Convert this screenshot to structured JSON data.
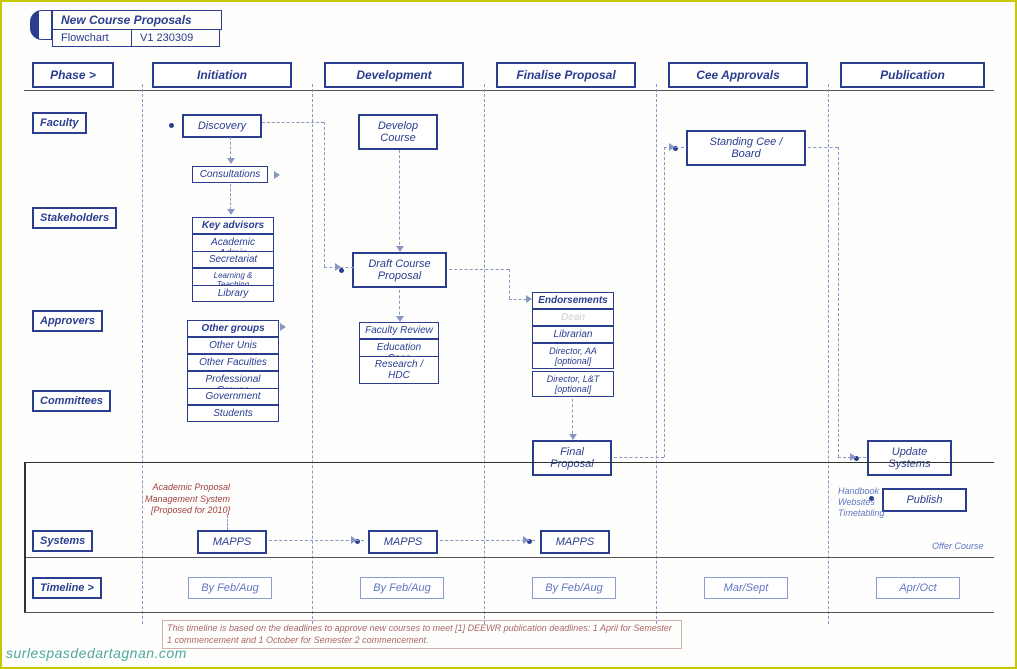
{
  "title": {
    "main": "New Course Proposals",
    "sub1": "Flowchart",
    "sub2": "V1 230309"
  },
  "phases": {
    "label": "Phase >",
    "cols": [
      "Initiation",
      "Development",
      "Finalise Proposal",
      "Cee Approvals",
      "Publication"
    ]
  },
  "rows": {
    "faculty": "Faculty",
    "stakeholders": "Stakeholders",
    "approvers": "Approvers",
    "committees": "Committees",
    "systems": "Systems",
    "timeline": "Timeline >"
  },
  "boxes": {
    "discovery": "Discovery",
    "consultations": "Consultations",
    "develop_course": "Develop Course",
    "draft_proposal": "Draft Course Proposal",
    "final_proposal": "Final Proposal",
    "standing_cee": "Standing Cee  / Board",
    "update_systems": "Update Systems",
    "publish": "Publish"
  },
  "small_boxes": {
    "stakeholders": [
      "Key advisors",
      "Academic Admin",
      "Secretariat",
      "Learning & Teaching",
      "Library"
    ],
    "other_groups": [
      "Other groups",
      "Other Unis",
      "Other Faculties",
      "Professional Groups",
      "Government",
      "Students"
    ],
    "reviewers": [
      "Faculty Review",
      "Education Cees",
      "Research / HDC"
    ],
    "endorsements": [
      "Endorsements",
      "Dean",
      "Librarian",
      "Director, AA [optional]",
      "Director, L&T [optional]"
    ],
    "mapps": "MAPPS"
  },
  "timeline": {
    "t1": "By Feb/Aug",
    "t2": "By Feb/Aug",
    "t3": "By Feb/Aug",
    "t4": "Mar/Sept",
    "t5": "Apr/Oct"
  },
  "notes": {
    "maroon": "Academic Proposal Management System [Proposed for 2010]",
    "deadline": "This timeline is based on the deadlines to approve new courses to meet [1] DEEWR publication deadlines: 1 April for Semester 1 commencement and 1 October for Semester 2 commencement.",
    "handbook": "Handbook Websites Timetabling",
    "offer": "Offer Course"
  },
  "watermark": "surlespasdedartagnan.com"
}
